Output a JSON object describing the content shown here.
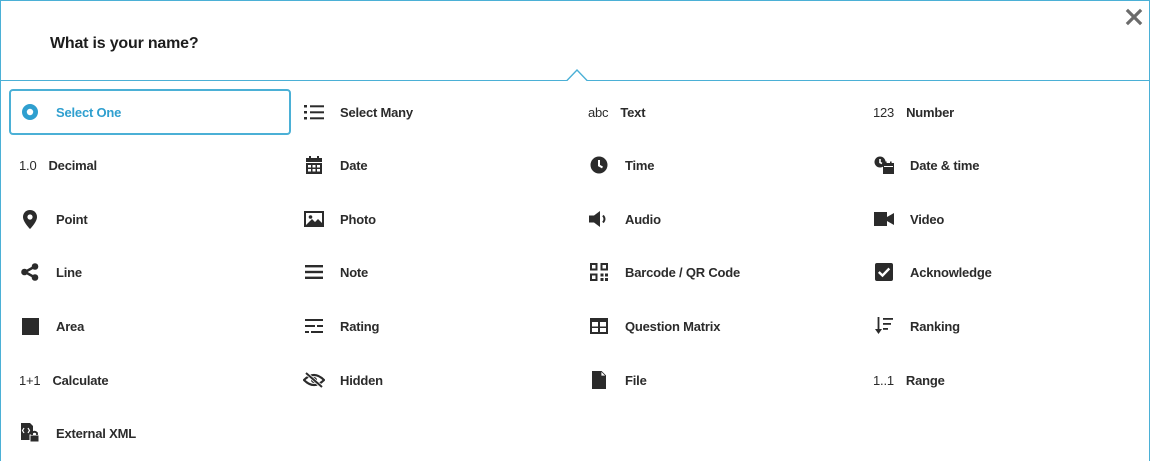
{
  "header": {
    "title": "What is your name?"
  },
  "types": [
    {
      "label": "Select One",
      "icon": "radio-icon",
      "selected": true
    },
    {
      "label": "Select Many",
      "icon": "list-icon"
    },
    {
      "label": "Text",
      "icon": "abc-icon",
      "glyph": "abc"
    },
    {
      "label": "Number",
      "icon": "number-icon",
      "glyph": "123"
    },
    {
      "label": "Decimal",
      "icon": "decimal-icon",
      "glyph": "1.0"
    },
    {
      "label": "Date",
      "icon": "calendar-icon"
    },
    {
      "label": "Time",
      "icon": "clock-icon"
    },
    {
      "label": "Date & time",
      "icon": "datetime-icon"
    },
    {
      "label": "Point",
      "icon": "map-pin-icon"
    },
    {
      "label": "Photo",
      "icon": "photo-icon"
    },
    {
      "label": "Audio",
      "icon": "speaker-icon"
    },
    {
      "label": "Video",
      "icon": "video-camera-icon"
    },
    {
      "label": "Line",
      "icon": "share-line-icon"
    },
    {
      "label": "Note",
      "icon": "note-lines-icon"
    },
    {
      "label": "Barcode / QR Code",
      "icon": "qr-code-icon"
    },
    {
      "label": "Acknowledge",
      "icon": "checkbox-icon"
    },
    {
      "label": "Area",
      "icon": "square-icon"
    },
    {
      "label": "Rating",
      "icon": "rating-icon"
    },
    {
      "label": "Question Matrix",
      "icon": "table-icon"
    },
    {
      "label": "Ranking",
      "icon": "sort-icon"
    },
    {
      "label": "Calculate",
      "icon": "calculate-icon",
      "glyph": "1+1"
    },
    {
      "label": "Hidden",
      "icon": "eye-slash-icon"
    },
    {
      "label": "File",
      "icon": "file-icon"
    },
    {
      "label": "Range",
      "icon": "range-icon",
      "glyph": "1..1"
    },
    {
      "label": "External XML",
      "icon": "external-xml-icon"
    }
  ]
}
